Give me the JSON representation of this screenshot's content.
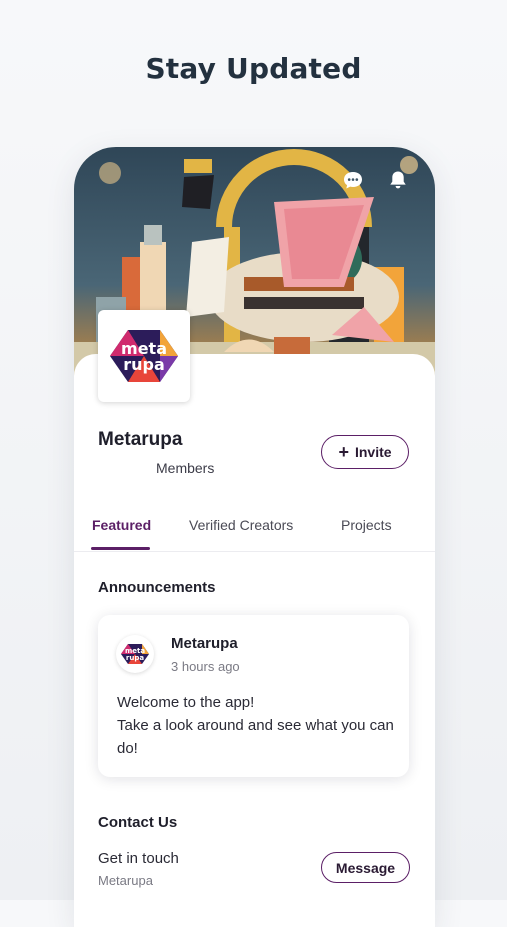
{
  "headline": "Stay Updated",
  "community": {
    "name": "Metarupa",
    "members_label": "Members",
    "logo_text_top": "meta",
    "logo_text_bottom": "rupa"
  },
  "actions": {
    "invite_label": "Invite",
    "invite_icon": "plus-icon"
  },
  "tabs": [
    {
      "label": "Featured",
      "active": true
    },
    {
      "label": "Verified Creators",
      "active": false
    },
    {
      "label": "Projects",
      "active": false
    }
  ],
  "announcements": {
    "title": "Announcements",
    "post": {
      "author": "Metarupa",
      "time": "3 hours ago",
      "body_line1": "Welcome to the app!",
      "body_line2": "Take a look around and see what you can do!"
    }
  },
  "contact": {
    "title": "Contact Us",
    "line1": "Get in touch",
    "line2": "Metarupa",
    "button_label": "Message"
  },
  "colors": {
    "accent": "#5b1f66",
    "headline": "#23313f",
    "sky": "#3d5566"
  }
}
